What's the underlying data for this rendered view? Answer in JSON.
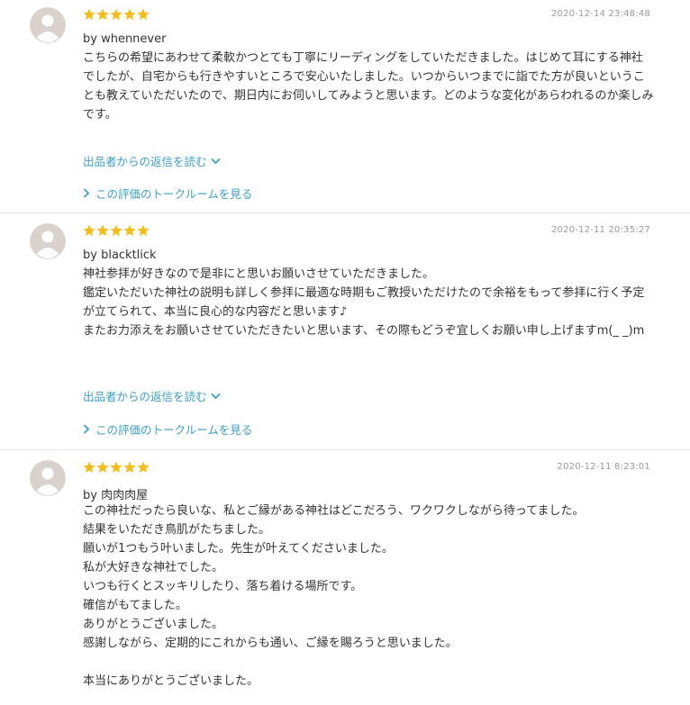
{
  "colors": {
    "star": "#f6bc17",
    "link": "#3a9fc5",
    "avatar_bg": "#d9d2cc",
    "avatar_face": "#ffffff"
  },
  "icons": {
    "star": "star-icon",
    "chevron_down": "chevron-down-icon",
    "chevron_right": "chevron-right-icon",
    "avatar": "user-avatar-icon"
  },
  "reviews": [
    {
      "rating": 5,
      "date": "2020-12-14 23:48:48",
      "author": "by whennever",
      "body": "こちらの希望にあわせて柔軟かつとても丁寧にリーディングをしていただきました。はじめて耳にする神社でしたが、自宅からも行きやすいところで安心いたしました。いつからいつまでに詣でた方が良いということも教えていただいたので、期日内にお伺いしてみようと思います。どのような変化があらわれるのか楽しみです。",
      "reply_link": "出品者からの返信を読む",
      "talk_link": "この評価のトークルームを見る"
    },
    {
      "rating": 5,
      "date": "2020-12-11 20:35:27",
      "author": "by blacktlick",
      "body": "神社参拝が好きなので是非にと思いお願いさせていただきました。\n鑑定いただいた神社の説明も詳しく参拝に最適な時期もご教授いただけたので余裕をもって参拝に行く予定が立てられて、本当に良心的な内容だと思います♪\nまたお力添えをお願いさせていただきたいと思います、その際もどうぞ宜しくお願い申し上げますm(_ _)m",
      "reply_link": "出品者からの返信を読む",
      "talk_link": "この評価のトークルームを見る"
    },
    {
      "rating": 5,
      "date": "2020-12-11 8:23:01",
      "author": "by 肉肉肉屋",
      "body": "この神社だったら良いな、私とご縁がある神社はどこだろう、ワクワクしながら待ってました。\n結果をいただき鳥肌がたちました。\n願いが1つもう叶いました。先生が叶えてくださいました。\n私が大好きな神社でした。\nいつも行くとスッキリしたり、落ち着ける場所です。\n確信がもてました。\nありがとうございました。\n感謝しながら、定期的にこれからも通い、ご縁を賜ろうと思いました。\n\n本当にありがとうございました。"
    }
  ]
}
